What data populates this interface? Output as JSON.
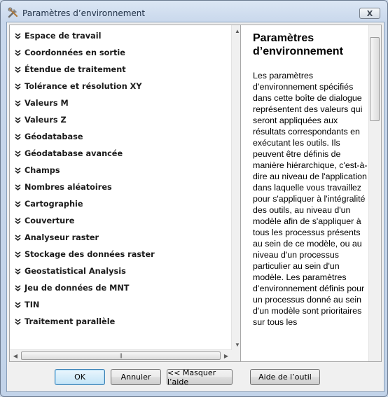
{
  "window": {
    "title": "Paramètres d’environnement",
    "close_label": "X"
  },
  "tree": {
    "items": [
      {
        "label": "Espace de travail"
      },
      {
        "label": "Coordonnées en sortie"
      },
      {
        "label": "Étendue de traitement"
      },
      {
        "label": "Tolérance et résolution XY"
      },
      {
        "label": "Valeurs M"
      },
      {
        "label": "Valeurs Z"
      },
      {
        "label": "Géodatabase"
      },
      {
        "label": "Géodatabase avancée"
      },
      {
        "label": "Champs"
      },
      {
        "label": "Nombres aléatoires"
      },
      {
        "label": "Cartographie"
      },
      {
        "label": "Couverture"
      },
      {
        "label": "Analyseur raster"
      },
      {
        "label": "Stockage des données raster"
      },
      {
        "label": "Geostatistical Analysis"
      },
      {
        "label": "Jeu de données de MNT"
      },
      {
        "label": "TIN"
      },
      {
        "label": "Traitement parallèle"
      }
    ],
    "chevron_icon": "double-chevron-down-icon"
  },
  "help": {
    "title": "Paramètres d’environnement",
    "body": "Les paramètres d’environnement spécifiés dans cette boîte de dialogue représentent des valeurs qui seront appliquées aux résultats correspondants en exécutant les outils. Ils peuvent être définis de manière hiérarchique, c'est-à-dire au niveau de l'application dans laquelle vous travaillez pour s'appliquer à l'intégralité des outils, au niveau d'un modèle afin de s'appliquer à tous les processus présents au sein de ce modèle, ou au niveau d'un processus particulier au sein d'un modèle. Les paramètres d’environnement définis pour un processus donné au sein d'un modèle sont prioritaires sur tous les"
  },
  "buttons": {
    "ok": "OK",
    "cancel": "Annuler",
    "hide_help": "<< Masquer l’aide",
    "tool_help": "Aide de l’outil"
  }
}
